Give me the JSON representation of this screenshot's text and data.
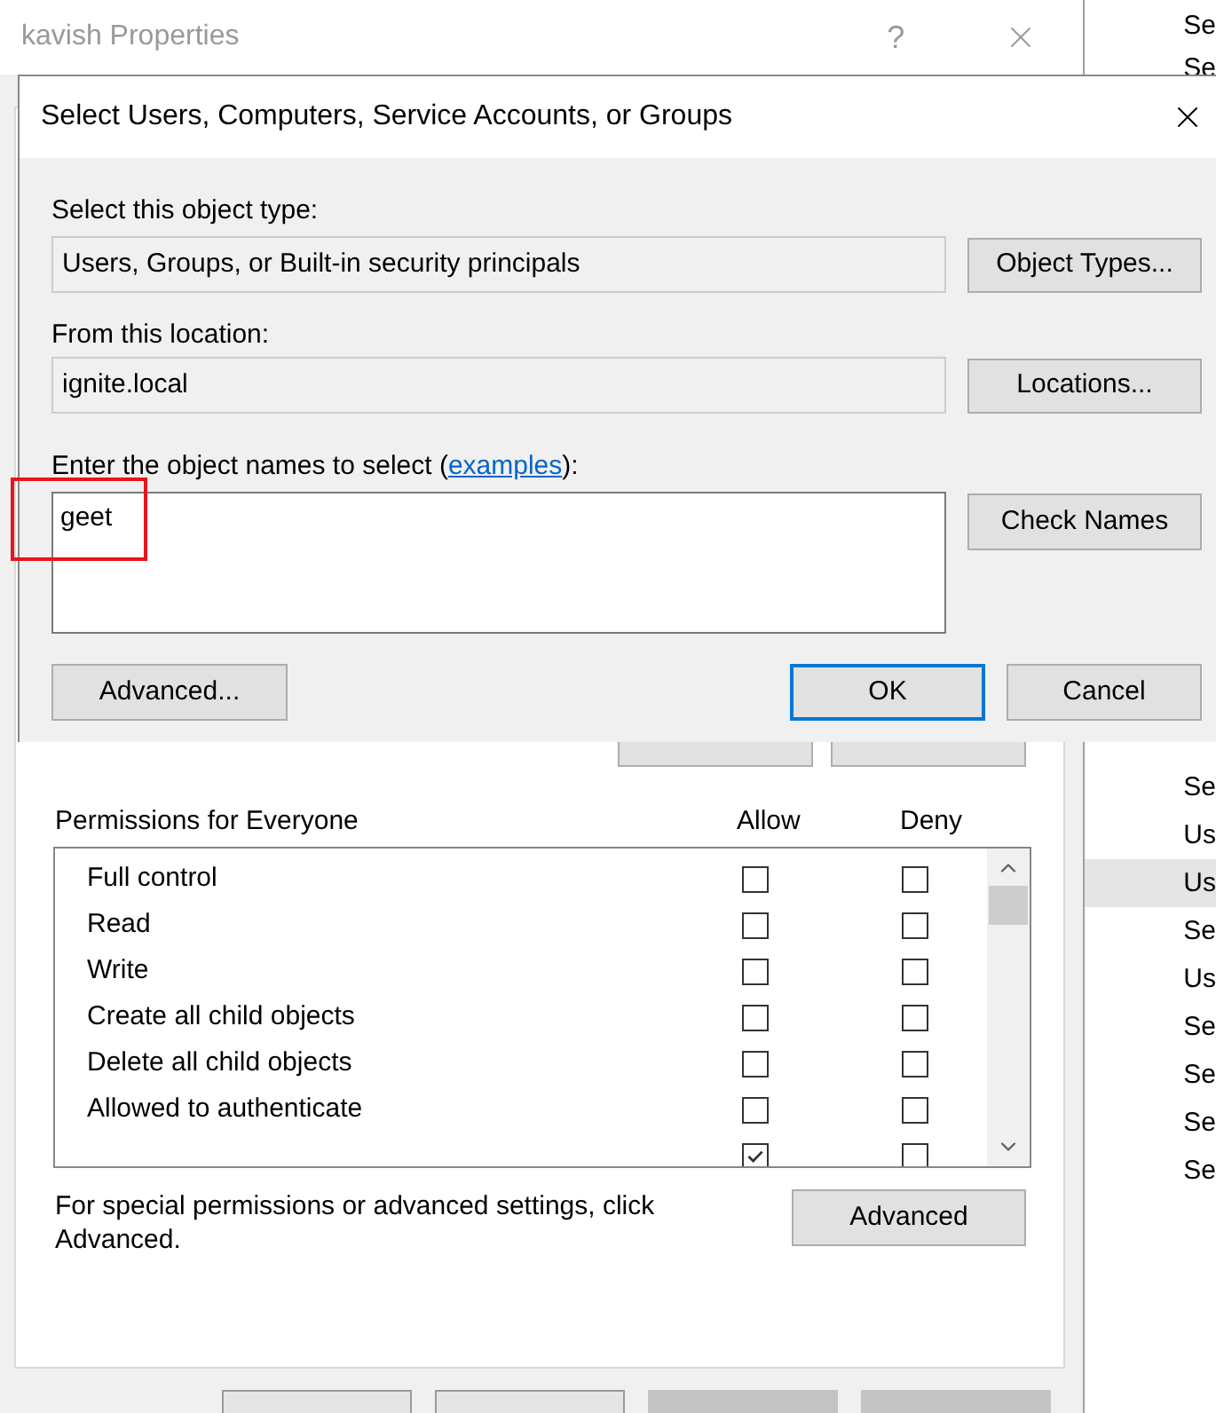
{
  "properties_window": {
    "title": "kavish Properties",
    "help_glyph": "?"
  },
  "member_buttons": [
    {
      "kind": "covered"
    },
    {
      "kind": "covered"
    }
  ],
  "permissions": {
    "header": "Permissions for Everyone",
    "columns": [
      "Allow",
      "Deny"
    ],
    "rows": [
      {
        "name": "Full control",
        "allow": false,
        "deny": false
      },
      {
        "name": "Read",
        "allow": false,
        "deny": false
      },
      {
        "name": "Write",
        "allow": false,
        "deny": false
      },
      {
        "name": "Create all child objects",
        "allow": false,
        "deny": false
      },
      {
        "name": "Delete all child objects",
        "allow": false,
        "deny": false
      },
      {
        "name": "Allowed to authenticate",
        "allow": false,
        "deny": false
      },
      {
        "allow": true,
        "deny": false
      }
    ]
  },
  "advanced_note": "For special permissions or advanced settings, click Advanced.",
  "advanced_button": "Advanced",
  "bottom_buttons": [
    {
      "disabled": false
    },
    {
      "disabled": false
    },
    {
      "disabled": true
    },
    {
      "disabled": true
    }
  ],
  "side_list": {
    "top_items": [
      {
        "text": "Se"
      },
      {
        "text": "Se"
      }
    ],
    "items": [
      {
        "text": "Se",
        "selected": false
      },
      {
        "text": "Us",
        "selected": false
      },
      {
        "text": "Us",
        "selected": true
      },
      {
        "text": "Se",
        "selected": false
      },
      {
        "text": "Us",
        "selected": false
      },
      {
        "text": "Se",
        "selected": false
      },
      {
        "text": "Se",
        "selected": false
      },
      {
        "text": "Se",
        "selected": false
      },
      {
        "text": "Se",
        "selected": false
      }
    ]
  },
  "dialog": {
    "title": "Select Users, Computers, Service Accounts, or Groups",
    "object_type_label": "Select this object type:",
    "object_type_value": "Users, Groups, or Built-in security principals",
    "object_types_button": "Object Types...",
    "location_label": "From this location:",
    "location_value": "ignite.local",
    "locations_button": "Locations...",
    "names_label_before": "Enter the object names to select (",
    "names_link": "examples",
    "names_label_after": "):",
    "names_value": "geet",
    "names_highlighted": true,
    "check_names_button": "Check Names",
    "advanced_button": "Advanced...",
    "ok_button": {
      "label": "OK",
      "focused": true
    },
    "cancel_button": "Cancel"
  }
}
